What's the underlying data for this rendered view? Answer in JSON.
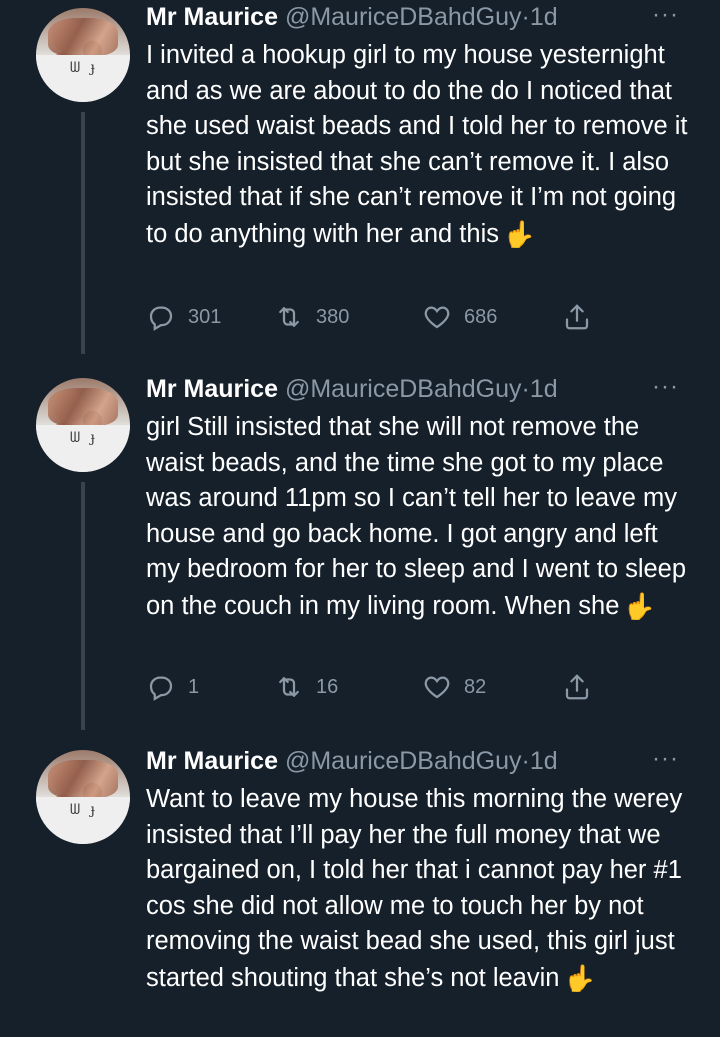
{
  "tweets": [
    {
      "name": "Mr Maurice",
      "handle": "@MauriceDBahdGuy",
      "separator": "·",
      "time": "1d",
      "more": "···",
      "text": "I invited a hookup girl to my house yesternight and as we are about to do the do I noticed that she used waist beads and I told her to remove it but she insisted that she can’t remove it. I also insisted that if she can’t remove it I’m not going to do anything with her and this",
      "emoji": "👇",
      "replies": "301",
      "retweets": "380",
      "likes": "686"
    },
    {
      "name": "Mr Maurice",
      "handle": "@MauriceDBahdGuy",
      "separator": "·",
      "time": "1d",
      "more": "···",
      "text": "girl Still insisted that she will not remove the waist beads, and the time she got to my place was around 11pm so I can’t tell her to leave my house and go back home. I got angry and left my bedroom for her to sleep and I went to sleep on the couch in my living room. When she",
      "emoji": "👇",
      "replies": "1",
      "retweets": "16",
      "likes": "82"
    },
    {
      "name": "Mr Maurice",
      "handle": "@MauriceDBahdGuy",
      "separator": "·",
      "time": "1d",
      "more": "···",
      "text": "Want to leave my house this morning the werey insisted that I’ll pay her the full money that we bargained on, I told her that i cannot pay her #1 cos she did not allow me to touch her by not removing the waist bead she used, this girl just started shouting that she’s not leavin",
      "emoji": "👇"
    }
  ],
  "icons": {
    "reply": "reply-icon",
    "retweet": "retweet-icon",
    "like": "heart-icon",
    "share": "share-icon",
    "more": "more-icon"
  },
  "colors": {
    "background": "#15202b",
    "secondary_text": "#8b98a5",
    "thread_line": "#38444d"
  }
}
